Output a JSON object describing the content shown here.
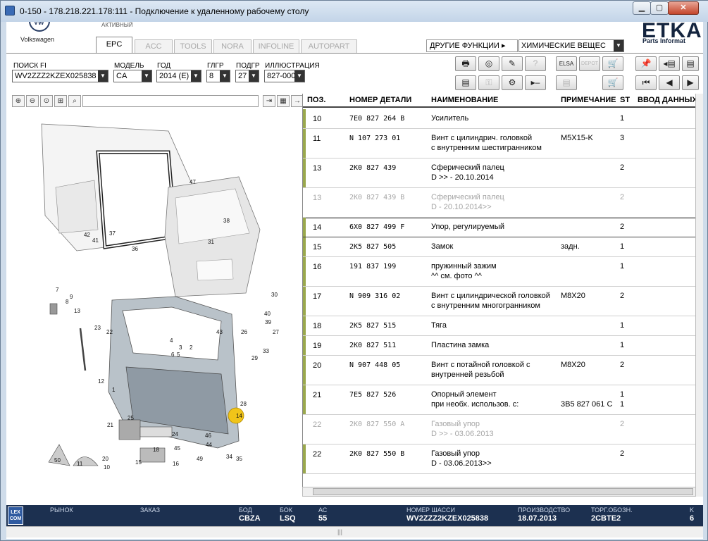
{
  "window": {
    "title": "0-150 - 178.218.221.178:111 - Подключение к удаленному рабочему столу",
    "minimize": "▁",
    "maximize": "▢",
    "close": "✕"
  },
  "header": {
    "brand": "Volkswagen",
    "top_text": "АКТИВНЫЙ",
    "etka_logo": "ETKA",
    "etka_sub": "Parts Informat"
  },
  "tabs": [
    {
      "label": "EPC"
    },
    {
      "label": "ACC"
    },
    {
      "label": "TOOLS"
    },
    {
      "label": "NORA"
    },
    {
      "label": "INFOLINE"
    },
    {
      "label": "AUTOPART"
    }
  ],
  "other_functions": {
    "label": "ДРУГИЕ ФУНКЦИИ ▸",
    "selected": "ХИМИЧЕСКИЕ ВЕЩЕС"
  },
  "filters": {
    "search_fi": {
      "label": "ПОИСК FI",
      "value": "WV2ZZZ2KZEX025838"
    },
    "model": {
      "label": "МОДЕЛЬ",
      "value": "CA"
    },
    "year": {
      "label": "ГОД",
      "value": "2014 (E)"
    },
    "hg": {
      "label": "ГЛГР",
      "value": "8"
    },
    "ug": {
      "label": "ПОДГР",
      "value": "27"
    },
    "illustration": {
      "label": "ИЛЛЮСТРАЦИЯ",
      "value": "827-000"
    }
  },
  "toolbar": {
    "row1": [
      "print-icon",
      "cd-icon",
      "tools-icon",
      "help-icon",
      "elsa-icon",
      "depot-icon",
      "cart-add-icon",
      "pin-icon",
      "doc-back-icon",
      "doc-forward-icon"
    ],
    "row2": [
      "list-icon",
      "key-icon",
      "bike-icon",
      "next-icon",
      "elsa2-icon",
      "cart-icon",
      "first-icon",
      "prev-icon",
      "next2-icon"
    ],
    "labels": {
      "print": "🖶",
      "cd": "◎",
      "tools": "✎",
      "help": "?",
      "elsa": "ELSA",
      "depot": "DEPOT",
      "cart_add": "🛒",
      "pin": "📌",
      "doc_back": "◂▤",
      "list": "▤",
      "key": "⚿",
      "bike": "⚙",
      "next": "▸‒",
      "cart": "🛒",
      "first": "⏮",
      "prev": "◀",
      "next2": "▶"
    }
  },
  "illustration_tools": [
    "zoom-in",
    "zoom-out",
    "zoom-fit",
    "zoom-region",
    "search"
  ],
  "table": {
    "headers": {
      "pos": "ПОЗ.",
      "part": "НОМЕР ДЕТАЛИ",
      "name": "НАИМЕНОВАНИЕ",
      "note": "ПРИМЕЧАНИЕ",
      "st": "ST",
      "input": "ВВОД ДАННЫХ"
    },
    "rows": [
      {
        "pos": "10",
        "part": "7E0  827  264  B",
        "name": "Усилитель",
        "name2": "",
        "note": "",
        "note2": "",
        "st": "1",
        "st2": "",
        "grey": false,
        "sel": false
      },
      {
        "pos": "11",
        "part": "N    107  273  01",
        "name": "Винт с цилиндрич. головкой",
        "name2": "с внутренним шестигранником",
        "note": "M5X15-K",
        "note2": "",
        "st": "3",
        "st2": "",
        "grey": false,
        "sel": false
      },
      {
        "pos": "13",
        "part": "2K0  827  439",
        "name": "Сферический палец",
        "name2": "D            >> - 20.10.2014",
        "note": "",
        "note2": "",
        "st": "2",
        "st2": "",
        "grey": false,
        "sel": false
      },
      {
        "pos": "13",
        "part": "2K0  827  439  B",
        "name": "Сферический палец",
        "name2": "D - 20.10.2014>>",
        "note": "",
        "note2": "",
        "st": "2",
        "st2": "",
        "grey": true,
        "sel": false
      },
      {
        "pos": "14",
        "part": "6X0  827  499  F",
        "name": "Упор, регулируемый",
        "name2": "",
        "note": "",
        "note2": "",
        "st": "2",
        "st2": "",
        "grey": false,
        "sel": true
      },
      {
        "pos": "15",
        "part": "2K5  827  505",
        "name": "Замок",
        "name2": "",
        "note": "задн.",
        "note2": "",
        "st": "1",
        "st2": "",
        "grey": false,
        "sel": false
      },
      {
        "pos": "16",
        "part": "191  837  199",
        "name": "пружинный зажим",
        "name2": "^^ см. фото ^^",
        "note": "",
        "note2": "",
        "st": "1",
        "st2": "",
        "grey": false,
        "sel": false
      },
      {
        "pos": "17",
        "part": "N    909  316  02",
        "name": "Винт с цилиндрической головкой",
        "name2": "с внутренним многогранником",
        "note": "M8X20",
        "note2": "",
        "st": "2",
        "st2": "",
        "grey": false,
        "sel": false
      },
      {
        "pos": "18",
        "part": "2K5  827  515",
        "name": "Тяга",
        "name2": "",
        "note": "",
        "note2": "",
        "st": "1",
        "st2": "",
        "grey": false,
        "sel": false
      },
      {
        "pos": "19",
        "part": "2K0  827  511",
        "name": "Пластина замка",
        "name2": "",
        "note": "",
        "note2": "",
        "st": "1",
        "st2": "",
        "grey": false,
        "sel": false
      },
      {
        "pos": "20",
        "part": "N    907  448  05",
        "name": "Винт с потайной головкой с",
        "name2": "внутренней резьбой",
        "note": "M8X20",
        "note2": "",
        "st": "2",
        "st2": "",
        "grey": false,
        "sel": false
      },
      {
        "pos": "21",
        "part": "7E5  827  526",
        "name": "Опорный элемент",
        "name2": "при необх. использов. с:",
        "note": "",
        "note2": "3B5 827 061 C",
        "st": "1",
        "st2": "1",
        "grey": false,
        "sel": false
      },
      {
        "pos": "22",
        "part": "2K0  827  550  A",
        "name": "Газовый упор",
        "name2": "D            >> - 03.06.2013",
        "note": "",
        "note2": "",
        "st": "2",
        "st2": "",
        "grey": true,
        "sel": false
      },
      {
        "pos": "22",
        "part": "2K0  827  550  B",
        "name": "Газовый упор",
        "name2": "D - 03.06.2013>>",
        "note": "",
        "note2": "",
        "st": "2",
        "st2": "",
        "grey": false,
        "sel": false
      }
    ]
  },
  "callouts": [
    "47",
    "38",
    "42",
    "41",
    "37",
    "36",
    "31",
    "7",
    "8",
    "13",
    "23",
    "22",
    "30",
    "40",
    "39",
    "27",
    "43",
    "26",
    "33",
    "29",
    "4",
    "2",
    "3",
    "6",
    "5",
    "1",
    "14",
    "28",
    "25",
    "21",
    "24",
    "18",
    "45",
    "44",
    "46",
    "49",
    "50",
    "11",
    "10",
    "20",
    "15",
    "16",
    "19",
    "17",
    "34",
    "35",
    "12",
    "9"
  ],
  "statusbar": {
    "logo": "LEX COM",
    "market": {
      "label": "РЫНОК",
      "value": ""
    },
    "order": {
      "label": "ЗАКАЗ",
      "value": ""
    },
    "bod": {
      "label": "БОД",
      "value": "CBZA"
    },
    "bok": {
      "label": "БОК",
      "value": "LSQ"
    },
    "ac": {
      "label": "АС",
      "value": "55"
    },
    "vin": {
      "label": "НОМЕР ШАССИ",
      "value": "WV2ZZZ2KZEX025838"
    },
    "prod": {
      "label": "ПРОИЗВОДСТВО",
      "value": "18.07.2013"
    },
    "trade": {
      "label": "ТОРГ.ОБОЗН.",
      "value": "2CBTE2"
    },
    "k": {
      "label": "K",
      "value": "6"
    }
  },
  "colors": {
    "status_bg": "#1c3050",
    "row_marker": "#9aa84d",
    "highlight_callout": "#f0c419"
  }
}
